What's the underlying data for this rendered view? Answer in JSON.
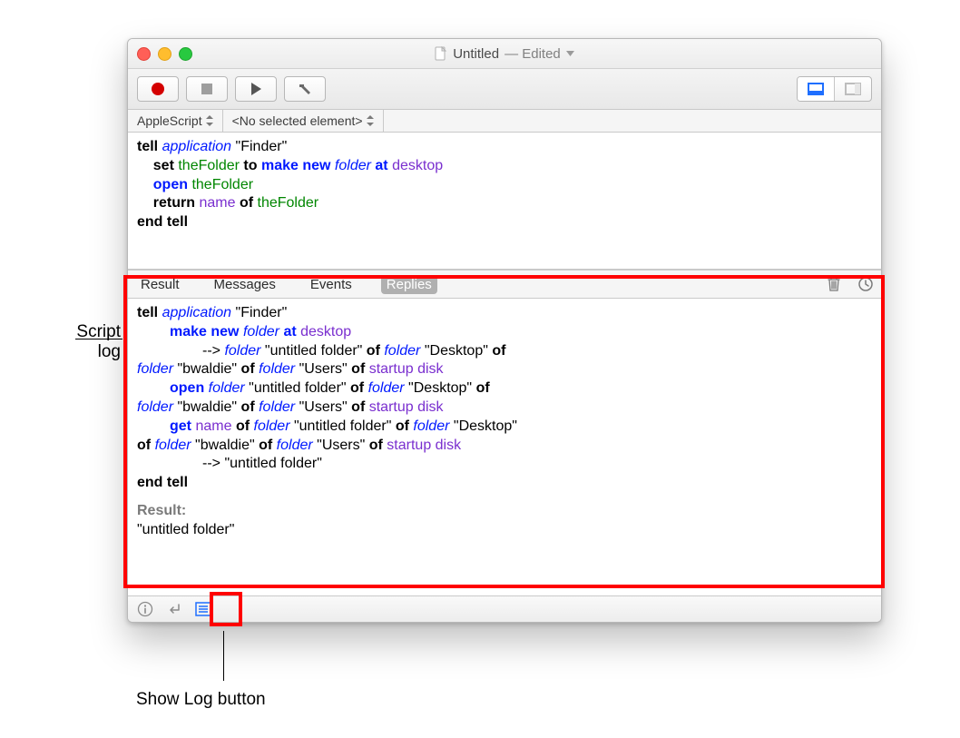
{
  "callouts": {
    "script_log_line1": "Script",
    "script_log_line2": "log",
    "show_log": "Show Log button"
  },
  "window": {
    "title_doc": "Untitled",
    "title_state": "— Edited"
  },
  "navbar": {
    "language": "AppleScript",
    "element": "<No selected element>"
  },
  "script": {
    "l1_tell": "tell",
    "l1_application": "application",
    "l1_finder": "\"Finder\"",
    "l2_set": "set",
    "l2_theFolder": "theFolder",
    "l2_to": "to",
    "l2_make": "make",
    "l2_new": "new",
    "l2_folder": "folder",
    "l2_at": "at",
    "l2_desktop": "desktop",
    "l3_open": "open",
    "l3_theFolder": "theFolder",
    "l4_return": "return",
    "l4_name": "name",
    "l4_of": "of",
    "l4_theFolder": "theFolder",
    "l5_end": "end tell"
  },
  "log_tabs": {
    "result": "Result",
    "messages": "Messages",
    "events": "Events",
    "replies": "Replies"
  },
  "log": {
    "a_tell": "tell",
    "a_application": "application",
    "a_finder": "\"Finder\"",
    "b_make": "make",
    "b_new": "new",
    "b_folder": "folder",
    "b_at": "at",
    "b_desktop": "desktop",
    "c_arrow": "--> ",
    "c_folder": "folder",
    "c_untitled": " \"untitled folder\" ",
    "c_of": "of",
    "c_folder2": "folder",
    "c_desktop": " \"Desktop\" ",
    "d_folder": "folder",
    "d_bwaldie": " \"bwaldie\" ",
    "d_of": "of",
    "d_folder2": "folder",
    "d_users": " \"Users\" ",
    "d_of2": "of",
    "d_startup": "startup disk",
    "e_open": "open",
    "e_folder": "folder",
    "e_untitled": " \"untitled folder\" ",
    "e_of": "of",
    "e_folder2": "folder",
    "e_desktop": " \"Desktop\" ",
    "f_folder": "folder",
    "f_bwaldie": " \"bwaldie\" ",
    "f_of": "of",
    "f_folder2": "folder",
    "f_users": " \"Users\" ",
    "f_of2": "of",
    "f_startup": "startup disk",
    "g_get": "get",
    "g_name": "name",
    "g_of": "of",
    "g_folder": "folder",
    "g_untitled": " \"untitled folder\" ",
    "g_of2": "of",
    "g_folder2": "folder",
    "g_desktop": " \"Desktop\" ",
    "h_of": "of",
    "h_folder": "folder",
    "h_bwaldie": " \"bwaldie\" ",
    "h_of2": "of",
    "h_folder2": "folder",
    "h_users": " \"Users\" ",
    "h_of3": "of",
    "h_startup": "startup disk",
    "i_arrow": "--> \"untitled folder\"",
    "j_end": "end tell",
    "result_label": "Result:",
    "result_value": "\"untitled folder\""
  }
}
